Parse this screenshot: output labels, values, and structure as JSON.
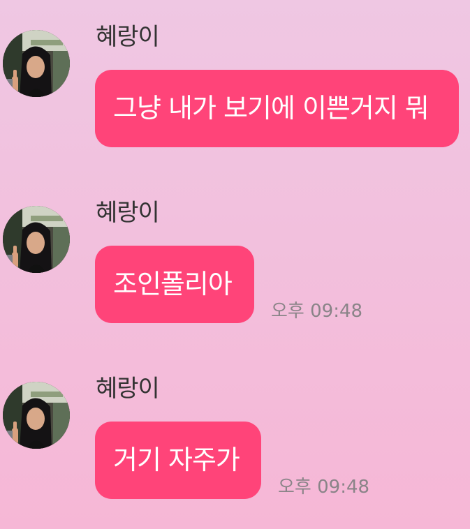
{
  "messages": [
    {
      "sender": "혜랑이",
      "text": "그냥 내가 보기에 이쁜거지 뭐",
      "time": ""
    },
    {
      "sender": "혜랑이",
      "text": "조인폴리아",
      "time": "오후 09:48"
    },
    {
      "sender": "혜랑이",
      "text": "거기 자주가",
      "time": "오후 09:48"
    }
  ],
  "colors": {
    "bubble": "#ff4479",
    "bubble_text": "#ffffff",
    "background_top": "#efc7e3",
    "background_bottom": "#f6b7d6",
    "sender_text": "#333333",
    "time_text": "#8a8488"
  }
}
